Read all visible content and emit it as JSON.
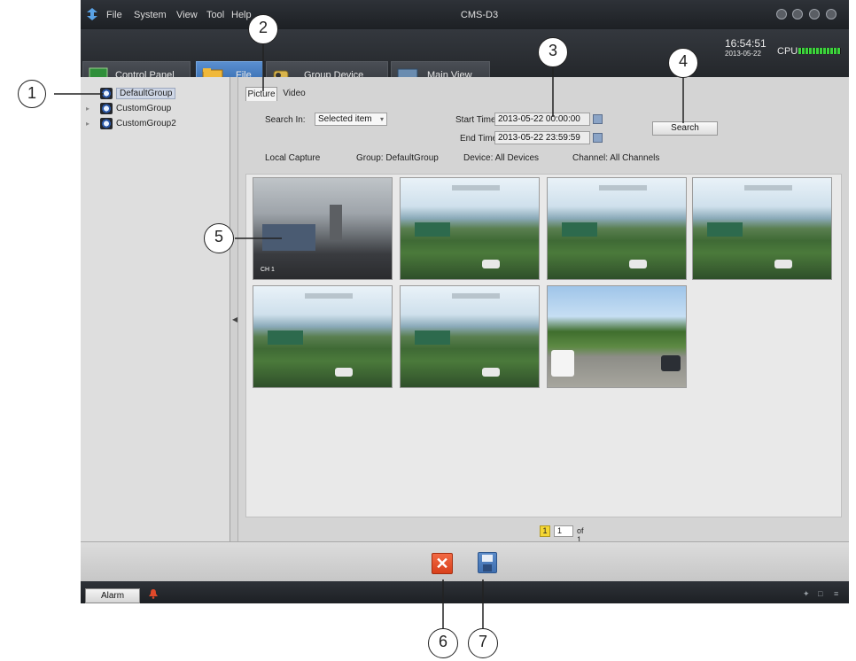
{
  "window": {
    "title": "CMS-D3",
    "menu": [
      "File",
      "System",
      "View",
      "Tool",
      "Help"
    ]
  },
  "tabs": [
    {
      "label": "Control Panel",
      "active": false
    },
    {
      "label": "File",
      "active": true
    },
    {
      "label": "Group Device",
      "active": false
    },
    {
      "label": "Main View",
      "active": false
    }
  ],
  "status": {
    "time": "16:54:51",
    "date": "2013-05-22",
    "cpu_label": "CPU"
  },
  "sidebar": {
    "groups": [
      {
        "label": "DefaultGroup",
        "selected": true
      },
      {
        "label": "CustomGroup",
        "selected": false
      },
      {
        "label": "CustomGroup2",
        "selected": false
      }
    ]
  },
  "content": {
    "subtabs": [
      {
        "label": "Picture",
        "active": true
      },
      {
        "label": "Video",
        "active": false
      }
    ],
    "search_in_label": "Search In:",
    "search_in_value": "Selected item",
    "start_time_label": "Start Time:",
    "start_time_value": "2013-05-22 00:00:00",
    "end_time_label": "End Time:",
    "end_time_value": "2013-05-22 23:59:59",
    "search_button": "Search",
    "filter": {
      "source": "Local Capture",
      "group": "Group: DefaultGroup",
      "device": "Device: All Devices",
      "channel": "Channel: All Channels"
    },
    "thumbnail_channel_label": "CH 1",
    "pager": {
      "current": "1",
      "input": "1",
      "of_label": "of 1"
    }
  },
  "bottom": {
    "alarm_tab": "Alarm"
  },
  "callouts": [
    "1",
    "2",
    "3",
    "4",
    "5",
    "6",
    "7"
  ]
}
